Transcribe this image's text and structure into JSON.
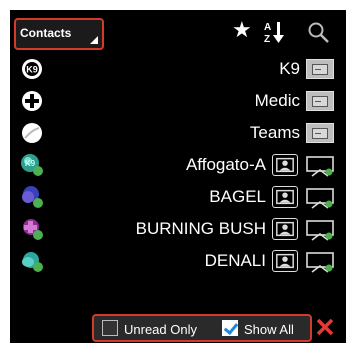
{
  "header": {
    "contacts_label": "Contacts",
    "sort_letters": "A Z"
  },
  "contacts": [
    {
      "name": "K9",
      "avatar": "k9-icon",
      "action": "card"
    },
    {
      "name": "Medic",
      "avatar": "medic-cross-icon",
      "action": "card"
    },
    {
      "name": "Teams",
      "avatar": "team-circle-icon",
      "action": "card"
    },
    {
      "name": "Affogato-A",
      "avatar": "user-avatar-icon",
      "status": "online",
      "action": "profile-screen"
    },
    {
      "name": "BAGEL",
      "avatar": "user-avatar-icon",
      "status": "online",
      "action": "profile-screen"
    },
    {
      "name": "BURNING BUSH",
      "avatar": "user-avatar-icon",
      "status": "online",
      "action": "profile-screen"
    },
    {
      "name": "DENALI",
      "avatar": "user-avatar-icon",
      "status": "online",
      "action": "profile-screen"
    }
  ],
  "footer": {
    "unread_only_label": "Unread Only",
    "unread_only_checked": false,
    "show_all_label": "Show All",
    "show_all_checked": true
  },
  "colors": {
    "highlight_border": "#d23a2c",
    "online_dot": "#4caf50",
    "close": "#e53935"
  }
}
